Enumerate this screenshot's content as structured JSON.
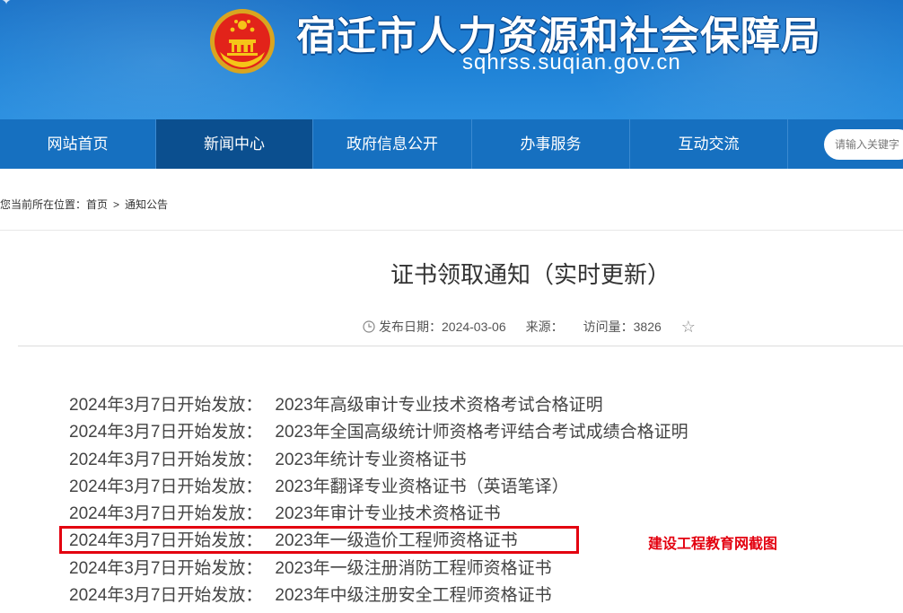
{
  "header": {
    "site_title": "宿迁市人力资源和社会保障局",
    "site_domain": "sqhrss.suqian.gov.cn",
    "corner_mark": "✦"
  },
  "nav": {
    "items": [
      {
        "label": "网站首页",
        "active": false
      },
      {
        "label": "新闻中心",
        "active": true
      },
      {
        "label": "政府信息公开",
        "active": false
      },
      {
        "label": "办事服务",
        "active": false
      },
      {
        "label": "互动交流",
        "active": false
      }
    ],
    "search_placeholder": "请输入关键字"
  },
  "breadcrumb": {
    "prefix": "您当前所在位置：",
    "home": "首页",
    "separator": ">",
    "current": "通知公告"
  },
  "article": {
    "title": "证书领取通知（实时更新）",
    "publish_label": "发布日期：",
    "publish_date": "2024-03-06",
    "source_label": "来源：",
    "views_label": "访问量：",
    "views": "3826",
    "notices": [
      {
        "date": "2024年3月7日开始发放：",
        "item": "2023年高级审计专业技术资格考试合格证明"
      },
      {
        "date": "2024年3月7日开始发放：",
        "item": "2023年全国高级统计师资格考评结合考试成绩合格证明"
      },
      {
        "date": "2024年3月7日开始发放：",
        "item": "2023年统计专业资格证书"
      },
      {
        "date": "2024年3月7日开始发放：",
        "item": "2023年翻译专业资格证书（英语笔译）"
      },
      {
        "date": "2024年3月7日开始发放：",
        "item": "2023年审计专业技术资格证书"
      },
      {
        "date": "2024年3月7日开始发放：",
        "item": "2023年一级造价工程师资格证书"
      },
      {
        "date": "2024年3月7日开始发放：",
        "item": "2023年一级注册消防工程师资格证书"
      },
      {
        "date": "2024年3月7日开始发放：",
        "item": "2023年中级注册安全工程师资格证书"
      }
    ]
  },
  "annotation": {
    "watermark": "建设工程教育网截图"
  },
  "colors": {
    "nav_bg": "#1670c0",
    "nav_active": "#0b4f8f",
    "highlight": "#e3000f"
  },
  "icons": [
    "national-emblem-icon",
    "clock-icon",
    "star-icon"
  ]
}
